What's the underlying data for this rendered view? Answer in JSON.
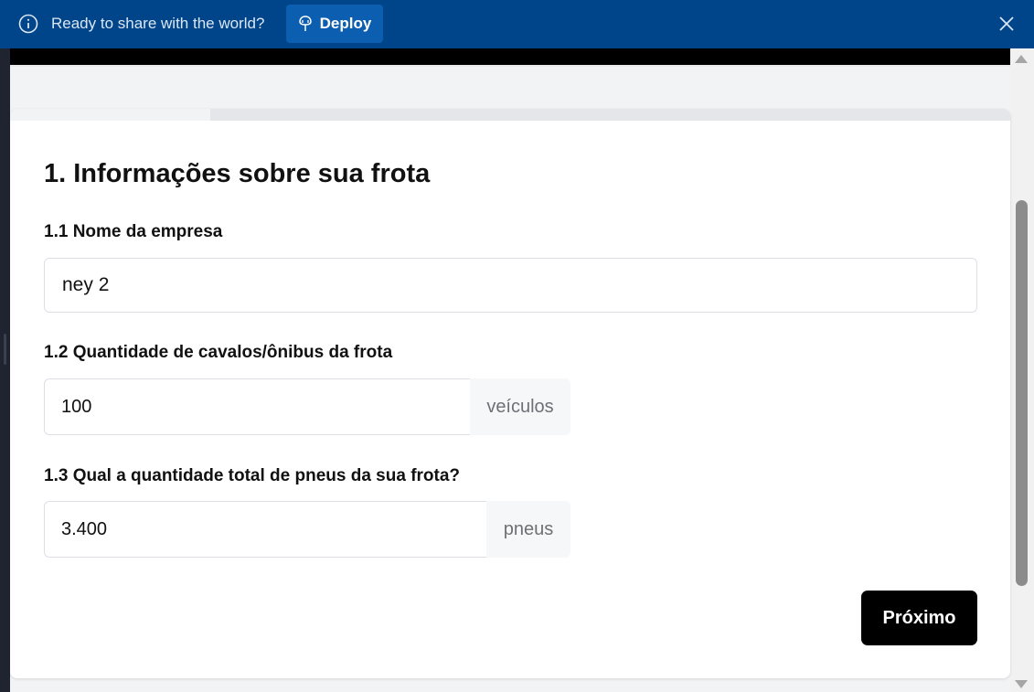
{
  "banner": {
    "message": "Ready to share with the world?",
    "deploy_label": "Deploy",
    "info_icon": "info-circle-icon",
    "deploy_icon": "deploy-icon",
    "close_icon": "close-icon",
    "background": "#00458a"
  },
  "form": {
    "progress_fraction": 0.2,
    "section_title": "1. Informações sobre sua frota",
    "company": {
      "label": "1.1 Nome da empresa",
      "value": "ney 2"
    },
    "vehicles": {
      "label": "1.2 Quantidade de cavalos/ônibus da frota",
      "value": "100",
      "unit": "veículos"
    },
    "tires": {
      "label": "1.3 Qual a quantidade total de pneus da sua frota?",
      "value": "3.400",
      "unit": "pneus"
    },
    "next_label": "Próximo"
  }
}
